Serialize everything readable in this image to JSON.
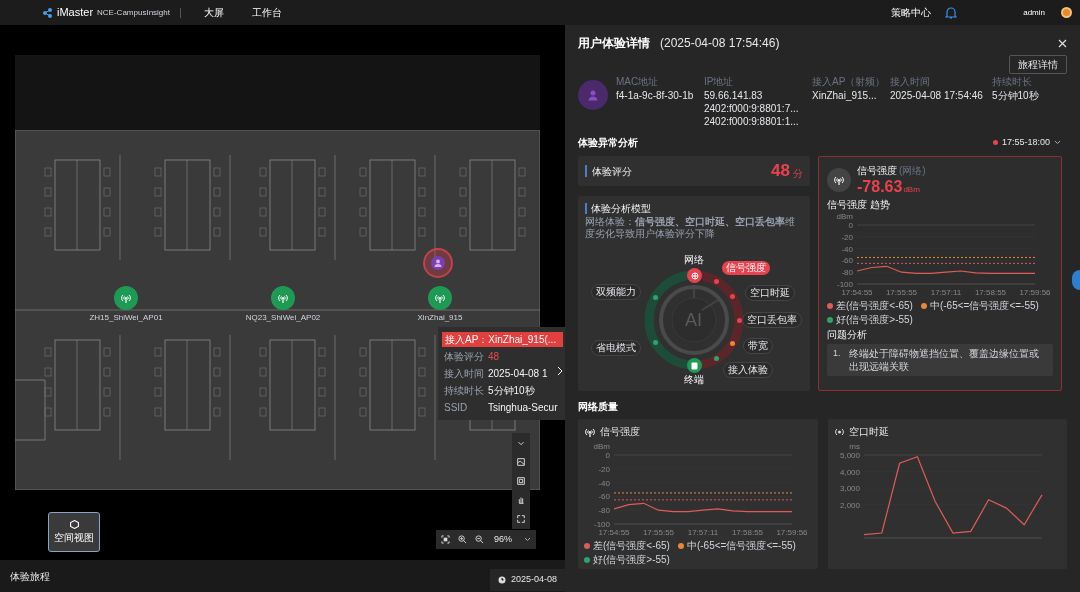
{
  "top_bar": {
    "logo": "iMaster",
    "product": "NCE-CampusInsight",
    "nav": [
      "大屏",
      "工作台"
    ],
    "policy_link": "策略中心",
    "user": "admin"
  },
  "map": {
    "access_points": [
      {
        "name": "ZH15_ShiWei_AP01"
      },
      {
        "name": "NQ23_ShiWei_AP02"
      },
      {
        "name": "XinZhai_915"
      }
    ],
    "tooltip": {
      "header": "接入AP：XinZhai_915(...",
      "rows": [
        {
          "label": "体验评分",
          "value": "48",
          "kind": "alert"
        },
        {
          "label": "接入时间",
          "value": "2025-04-08 1",
          "kind": "normal"
        },
        {
          "label": "持续时长",
          "value": "5分钟10秒",
          "kind": "normal"
        },
        {
          "label": "SSID",
          "value": "Tsinghua-Secur",
          "kind": "normal"
        }
      ]
    },
    "zoom": "96%",
    "view_button": "空间视图"
  },
  "journey": {
    "title": "体验旅程",
    "date": "2025-04-08"
  },
  "panel": {
    "title": "用户体验详情",
    "timestamp": "(2025-04-08 17:54:46)",
    "journey_button": "旅程详情",
    "fields": [
      {
        "label": "MAC地址",
        "lines": [
          "f4-1a-9c-8f-30-1b"
        ]
      },
      {
        "label": "IP地址",
        "lines": [
          "59.66.141.83",
          "2402:f000:9:8801:7...",
          "2402:f000:9:8801:1..."
        ]
      },
      {
        "label": "接入AP（射频）",
        "lines": [
          "XinZhai_915..."
        ]
      },
      {
        "label": "接入时间",
        "lines": [
          "2025-04-08 17:54:46"
        ]
      },
      {
        "label": "持续时长",
        "lines": [
          "5分钟10秒"
        ]
      }
    ],
    "anomaly": {
      "title": "体验异常分析",
      "period": "17:55-18:00",
      "score": {
        "label": "体验评分",
        "value": "48",
        "unit": "分"
      },
      "model": {
        "title": "体验分析模型",
        "description": "网络体验：**信号强度、空口时延、空口丢包率**维度劣化导致用户体验评分下降",
        "center": "AI",
        "network": "网络",
        "terminal": "终端",
        "factors": [
          {
            "label": "信号强度",
            "color": "#e8424f",
            "selected": true
          },
          {
            "label": "空口时延",
            "color": "#e8424f",
            "selected": false
          },
          {
            "label": "空口丢包率",
            "color": "#e8424f",
            "selected": false
          },
          {
            "label": "带宽",
            "color": "#e8873a",
            "selected": false
          },
          {
            "label": "接入体验",
            "color": "#2fa36b",
            "selected": false
          },
          {
            "label": "双频能力",
            "color": "#2fa36b",
            "selected": false
          },
          {
            "label": "省电模式",
            "color": "#2fa36b",
            "selected": false
          }
        ]
      },
      "detail": {
        "title": "信号强度",
        "qualifier": "(网络)",
        "value": "-78.63",
        "unit": "dBm",
        "trend_title": "信号强度 趋势",
        "chart_data": {
          "type": "line",
          "ylabel": "dBm",
          "categories": [
            "17:54:55",
            null,
            null,
            "17:55:55",
            null,
            null,
            "17:57:11",
            null,
            null,
            "17:58:55",
            null,
            null,
            "17:59:56"
          ],
          "series": [
            {
              "color": "#e05a5a",
              "values": [
                -78,
                -72,
                -70,
                -80,
                -82,
                -82,
                -80,
                -78,
                -81,
                -82,
                -82,
                -82,
                -82
              ]
            },
            {
              "color": "#e8873a",
              "line_style": "dashed",
              "values": [
                -55,
                -55,
                -55,
                -55,
                -55,
                -55,
                -55,
                -55,
                -55,
                -55,
                -55,
                -55,
                -55
              ]
            },
            {
              "color": "#e05a5b",
              "line_style": "dashed",
              "values": [
                -65,
                -65,
                -65,
                -65,
                -65,
                -65,
                -65,
                -65,
                -65,
                -65,
                -65,
                -65,
                -65
              ]
            }
          ],
          "ylim": [
            -100,
            0
          ],
          "yticks": [
            0,
            -20,
            -40,
            -60,
            -80,
            -100
          ]
        },
        "legend": [
          {
            "label": "差(信号强度<-65)",
            "color": "#e05a5a"
          },
          {
            "label": "中(-65<=信号强度<=-55)",
            "color": "#e8873a"
          },
          {
            "label": "好(信号强度>-55)",
            "color": "#2fa36b"
          }
        ],
        "issues_title": "问题分析",
        "issues": [
          {
            "index": "1.",
            "text": "终端处于障碍物遮挡位置、覆盖边缘位置或出现远端关联"
          }
        ]
      }
    },
    "quality": {
      "title": "网络质量",
      "cards": [
        {
          "title": "信号强度",
          "chart_data": {
            "type": "line",
            "ylabel": "dBm",
            "categories": [
              "17:54:55",
              null,
              null,
              "17:55:55",
              null,
              null,
              "17:57:11",
              null,
              null,
              "17:58:55",
              null,
              null,
              "17:59:56"
            ],
            "series": [
              {
                "color": "#e05a5a",
                "values": [
                  -78,
                  -72,
                  -70,
                  -80,
                  -82,
                  -82,
                  -80,
                  -78,
                  -81,
                  -82,
                  -82,
                  -82,
                  -82
                ]
              },
              {
                "color": "#e8873a",
                "line_style": "dashed",
                "values": [
                  -55,
                  -55,
                  -55,
                  -55,
                  -55,
                  -55,
                  -55,
                  -55,
                  -55,
                  -55,
                  -55,
                  -55,
                  -55
                ]
              },
              {
                "color": "#e05a5b",
                "line_style": "dashed",
                "values": [
                  -65,
                  -65,
                  -65,
                  -65,
                  -65,
                  -65,
                  -65,
                  -65,
                  -65,
                  -65,
                  -65,
                  -65,
                  -65
                ]
              }
            ],
            "ylim": [
              -100,
              0
            ],
            "yticks": [
              0,
              -20,
              -40,
              -60,
              -80,
              -100
            ]
          },
          "legend": [
            {
              "label": "差(信号强度<-65)",
              "color": "#e05a5a"
            },
            {
              "label": "中(-65<=信号强度<=-55)",
              "color": "#e8873a"
            },
            {
              "label": "好(信号强度>-55)",
              "color": "#2fa36b"
            }
          ]
        },
        {
          "title": "空口时延",
          "chart_data": {
            "type": "line",
            "ylabel": "ms",
            "categories": [
              null,
              null,
              null,
              null,
              null,
              null,
              null,
              null,
              null,
              null,
              null
            ],
            "series": [
              {
                "color": "#e05a5a",
                "values": [
                  200,
                  300,
                  4500,
                  4900,
                  2200,
                  300,
                  400,
                  2300,
                  1800,
                  800,
                  2600
                ]
              }
            ],
            "ylim": [
              0,
              5000
            ],
            "yticks": [
              {
                "value": 5000,
                "label": "5,000"
              },
              {
                "value": 4000,
                "label": "4,000"
              },
              {
                "value": 3000,
                "label": "3,000"
              },
              {
                "value": 2000,
                "label": "2,000"
              }
            ]
          }
        }
      ]
    }
  }
}
